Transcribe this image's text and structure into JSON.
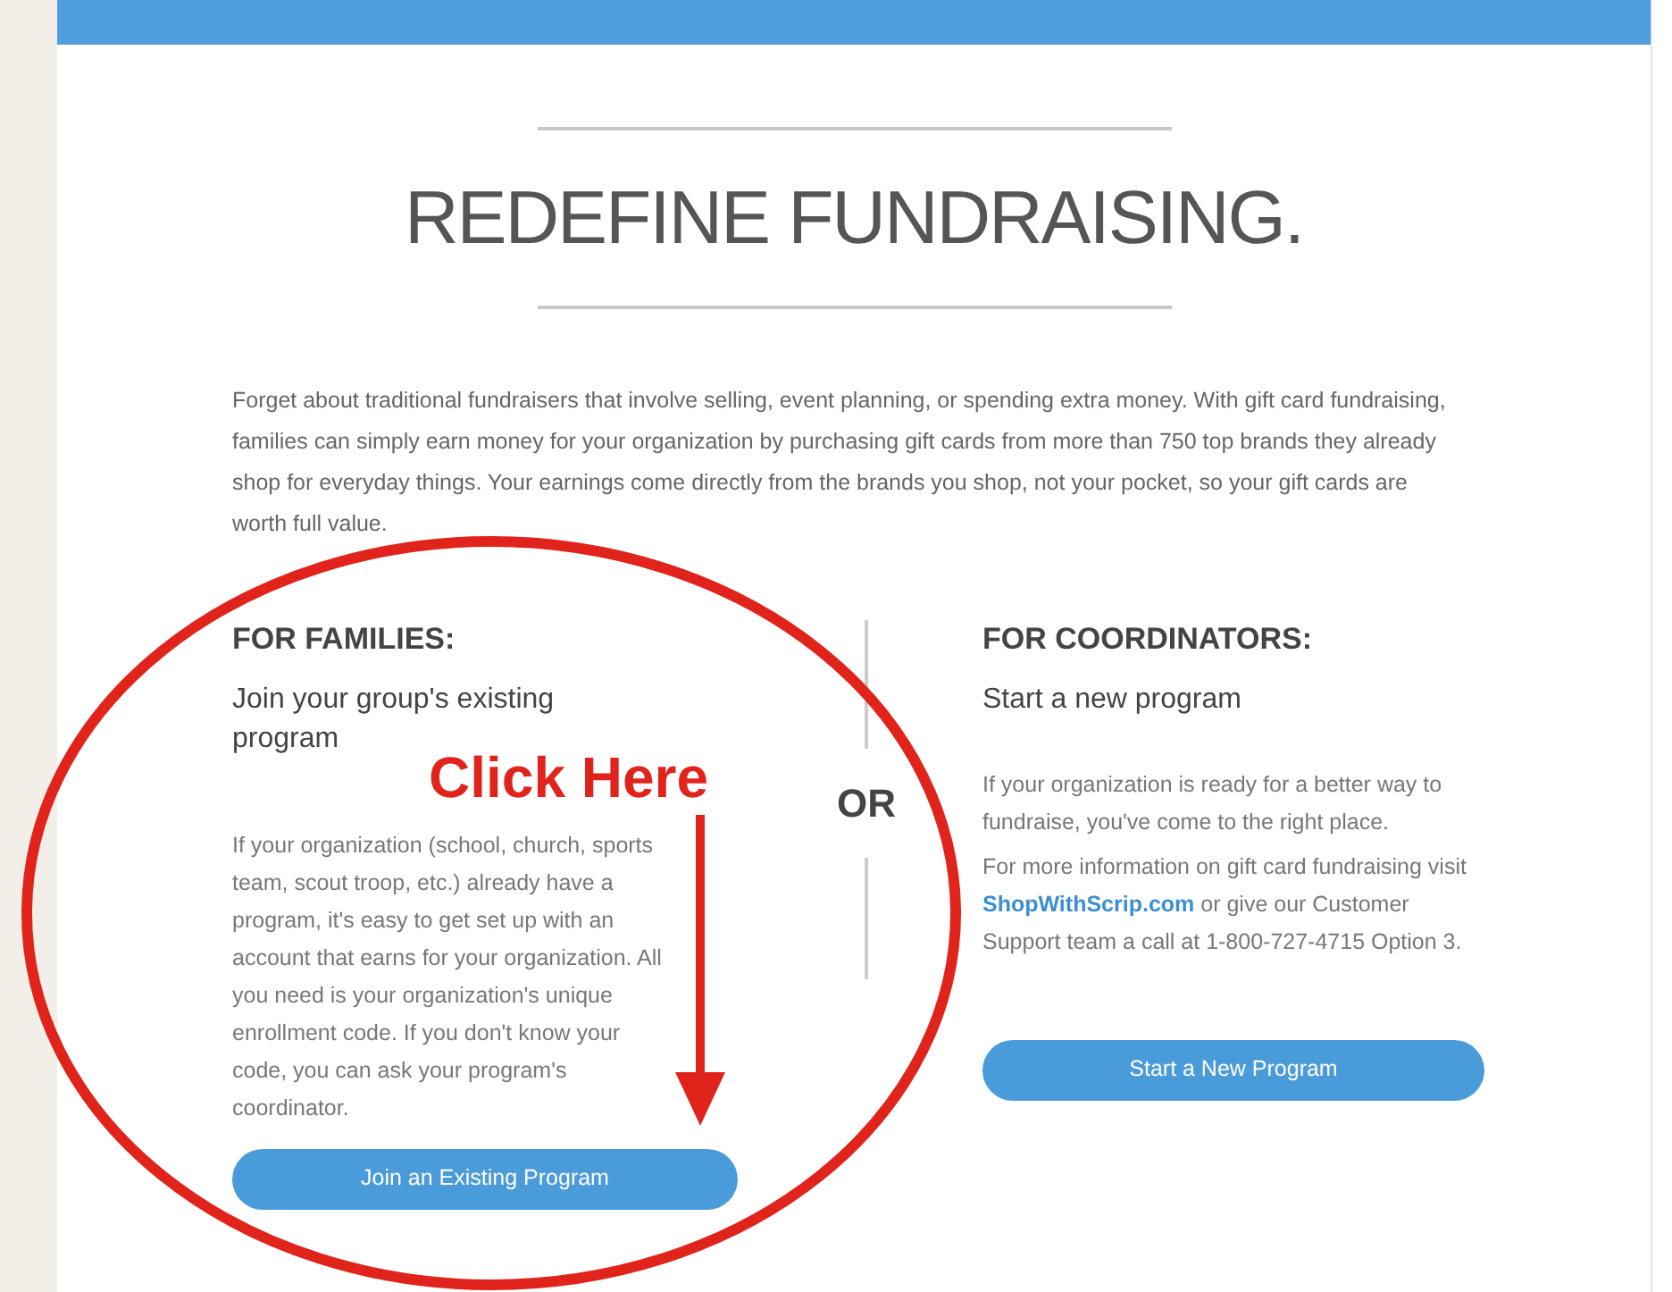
{
  "title": "REDEFINE FUNDRAISING.",
  "intro": "Forget about traditional fundraisers that involve selling, event planning, or spending extra money. With gift card fundraising, families can simply earn money for your organization by purchasing gift cards from more than 750 top brands they already shop for everyday things. Your earnings come directly from the brands you shop, not your pocket, so your gift cards are worth full value.",
  "families": {
    "heading": "FOR FAMILIES:",
    "subheading": "Join your group's existing program",
    "body": "If your organization (school, church, sports team, scout troop, etc.) already have a program, it's easy to get set up with an account that earns for your organization. All you need is your organization's unique enrollment code. If you don't know your code, you can ask your program's coordinator.",
    "button": "Join an Existing Program"
  },
  "divider_label": "OR",
  "coordinators": {
    "heading": "FOR COORDINATORS:",
    "subheading": "Start a new program",
    "body": "If your organization is ready for a better way to fundraise, you've come to the right place.",
    "info_before": "For more information on gift card fundraising visit",
    "link": "ShopWithScrip.com",
    "info_after": "or give our Customer Support team a call at 1-800-727-4715 Option 3.",
    "button": "Start a New Program"
  },
  "annotation": {
    "label": "Click Here"
  }
}
